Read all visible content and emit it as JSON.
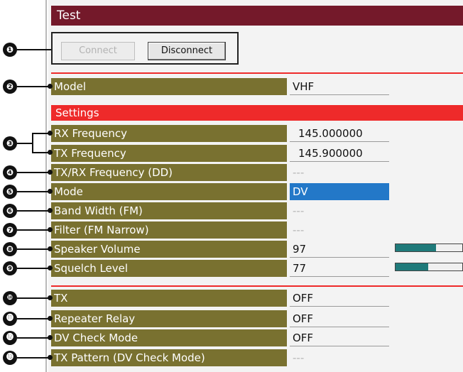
{
  "title": "Test",
  "buttons": {
    "connect": "Connect",
    "disconnect": "Disconnect"
  },
  "model": {
    "label": "Model",
    "value": "VHF"
  },
  "settings_header": "Settings",
  "settings": {
    "rx_frequency": {
      "label": "RX Frequency",
      "value": "145.000000"
    },
    "tx_frequency": {
      "label": "TX Frequency",
      "value": "145.900000"
    },
    "txrx_frequency_dd": {
      "label": "TX/RX Frequency (DD)",
      "value": "---"
    },
    "mode": {
      "label": "Mode",
      "value": "DV"
    },
    "band_width": {
      "label": "Band Width (FM)",
      "value": "---"
    },
    "filter": {
      "label": "Filter (FM Narrow)",
      "value": "---"
    },
    "speaker_volume": {
      "label": "Speaker Volume",
      "value": "97",
      "level": 0.61
    },
    "squelch_level": {
      "label": "Squelch Level",
      "value": "77",
      "level": 0.49
    }
  },
  "tx_section": {
    "tx": {
      "label": "TX",
      "value": "OFF"
    },
    "repeater_relay": {
      "label": "Repeater Relay",
      "value": "OFF"
    },
    "dv_check_mode": {
      "label": "DV Check Mode",
      "value": "OFF"
    },
    "tx_pattern": {
      "label": "TX Pattern (DV Check Mode)",
      "value": "---"
    }
  },
  "callouts": [
    "❶",
    "❷",
    "❸",
    "❹",
    "❺",
    "❻",
    "❼",
    "❽",
    "❾",
    "❿",
    "⓫",
    "⓬",
    "⓭"
  ],
  "colors": {
    "title_bar": "#74192a",
    "field_label": "#797130",
    "section_red": "#ee2a2a",
    "selected": "#2378c8",
    "slider_fill": "#1f7a7a"
  }
}
